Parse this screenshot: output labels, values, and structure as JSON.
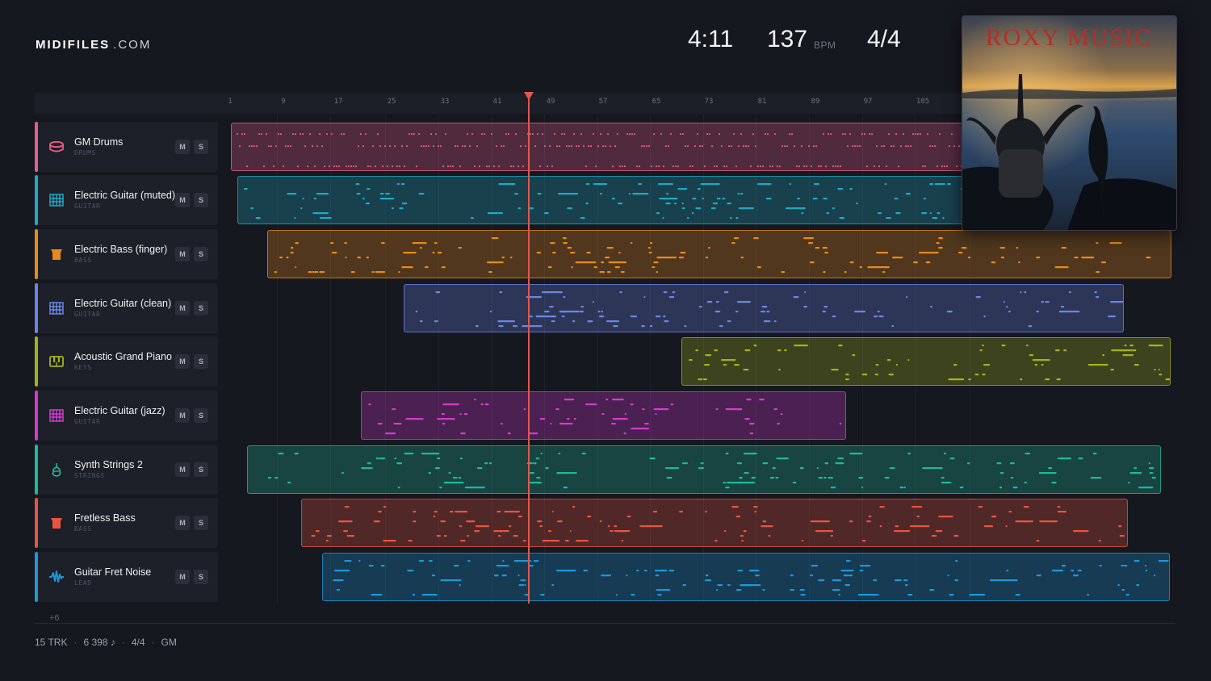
{
  "brand": {
    "name": "MIDIFILES",
    "domain": ".COM"
  },
  "transport": {
    "time": "4:11",
    "bpm": "137",
    "bpm_unit": "BPM",
    "time_signature": "4/4"
  },
  "ruler": {
    "ticks": [
      "1",
      "9",
      "17",
      "25",
      "33",
      "41",
      "49",
      "57",
      "65",
      "73",
      "81",
      "89",
      "97",
      "105"
    ]
  },
  "album": {
    "title": "ROXY MUSIC",
    "text_color": "#b0302a"
  },
  "tracks": [
    {
      "name": "GM Drums",
      "category": "DRUMS",
      "color": "#e85d8c",
      "icon": "drum-icon",
      "mute_label": "M",
      "solo_label": "S"
    },
    {
      "name": "Electric Guitar (muted)",
      "category": "GUITAR",
      "color": "#1fa9c4",
      "icon": "guitar-fretboard-icon",
      "mute_label": "M",
      "solo_label": "S"
    },
    {
      "name": "Electric Bass (finger)",
      "category": "BASS",
      "color": "#e88a1a",
      "icon": "bass-icon",
      "mute_label": "M",
      "solo_label": "S"
    },
    {
      "name": "Electric Guitar (clean)",
      "category": "GUITAR",
      "color": "#6b86e8",
      "icon": "guitar-fretboard-icon",
      "mute_label": "M",
      "solo_label": "S"
    },
    {
      "name": "Acoustic Grand Piano",
      "category": "KEYS",
      "color": "#a3b21c",
      "icon": "piano-keys-icon",
      "mute_label": "M",
      "solo_label": "S"
    },
    {
      "name": "Electric Guitar (jazz)",
      "category": "GUITAR",
      "color": "#d43ad0",
      "icon": "guitar-fretboard-icon",
      "mute_label": "M",
      "solo_label": "S"
    },
    {
      "name": "Synth Strings 2",
      "category": "STRINGS",
      "color": "#20b89a",
      "icon": "strings-icon",
      "mute_label": "M",
      "solo_label": "S"
    },
    {
      "name": "Fretless Bass",
      "category": "BASS",
      "color": "#e8543f",
      "icon": "bass-icon",
      "mute_label": "M",
      "solo_label": "S"
    },
    {
      "name": "Guitar Fret Noise",
      "category": "LEAD",
      "color": "#1e96d8",
      "icon": "waveform-icon",
      "mute_label": "M",
      "solo_label": "S"
    }
  ],
  "more_tracks": "+6",
  "footer": {
    "tracks": "15 TRK",
    "notes": "6 398 ♪",
    "time_signature": "4/4",
    "standard": "GM"
  }
}
